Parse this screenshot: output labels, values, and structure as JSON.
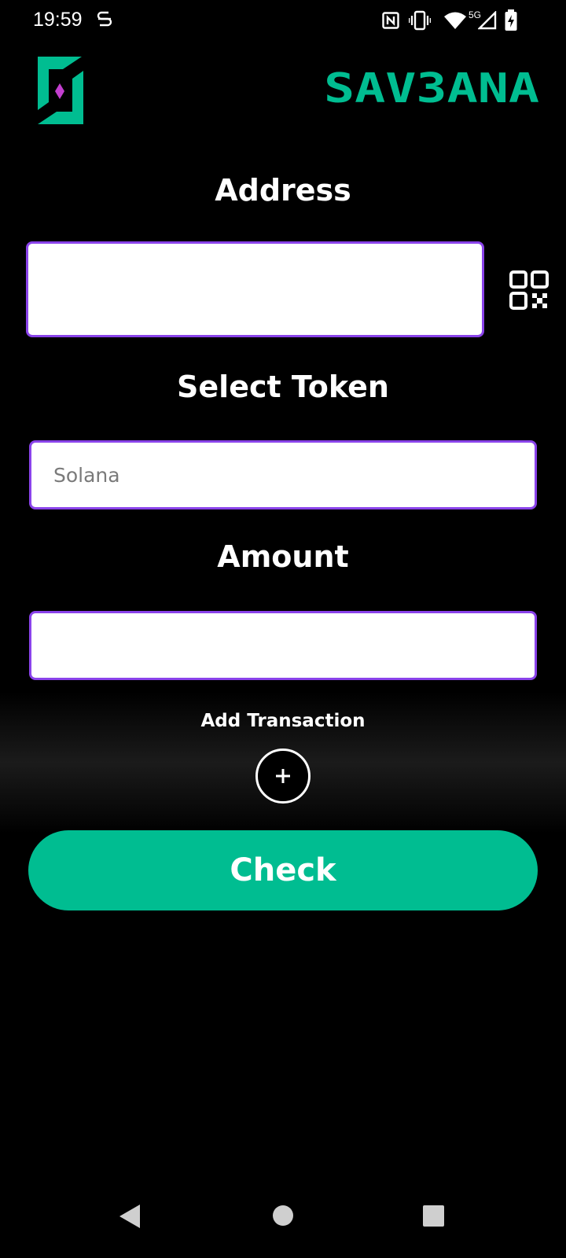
{
  "status_bar": {
    "time": "19:59",
    "network": "5G",
    "icons": [
      "nfc-icon",
      "vibrate-icon",
      "wifi-icon",
      "signal-icon",
      "battery-charging-icon"
    ]
  },
  "header": {
    "brand": "SAV3ANA",
    "logo_icon": "savana-logo-icon"
  },
  "colors": {
    "accent_green": "#00bd91",
    "accent_purple": "#8a43ea",
    "brand_magenta": "#c33fcf",
    "background": "#000000"
  },
  "form": {
    "address_label": "Address",
    "address_value": "",
    "qr_icon": "qr-code-icon",
    "token_label": "Select Token",
    "token_value": "Solana",
    "amount_label": "Amount",
    "amount_value": ""
  },
  "actions": {
    "add_transaction_label": "Add Transaction",
    "add_icon": "plus-icon",
    "check_label": "Check"
  },
  "nav_bar": {
    "icons": [
      "back-icon",
      "home-icon",
      "recents-icon"
    ]
  }
}
